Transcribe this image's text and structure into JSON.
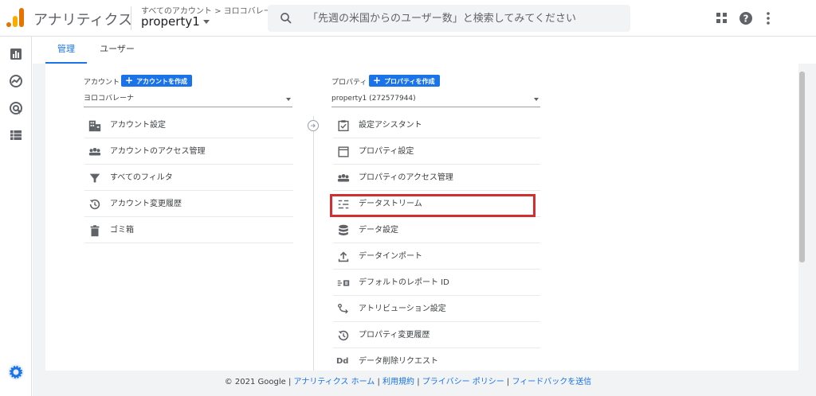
{
  "header": {
    "app_title": "アナリティクス",
    "breadcrumb": "すべてのアカウント > ヨロコバレーナ",
    "property_name": "property1",
    "search_placeholder": "「先週の米国からのユーザー数」と検索してみてください"
  },
  "tabs": [
    {
      "label": "管理",
      "active": true
    },
    {
      "label": "ユーザー",
      "active": false
    }
  ],
  "account": {
    "label": "アカウント",
    "create_label": "アカウントを作成",
    "selected": "ヨロコバレーナ",
    "items": [
      {
        "label": "アカウント設定",
        "icon": "building-icon"
      },
      {
        "label": "アカウントのアクセス管理",
        "icon": "people-icon"
      },
      {
        "label": "すべてのフィルタ",
        "icon": "filter-icon"
      },
      {
        "label": "アカウント変更履歴",
        "icon": "history-icon"
      },
      {
        "label": "ゴミ箱",
        "icon": "trash-icon"
      }
    ]
  },
  "property": {
    "label": "プロパティ",
    "create_label": "プロパティを作成",
    "selected": "property1 (272577944)",
    "items": [
      {
        "label": "設定アシスタント",
        "icon": "checkbox-icon"
      },
      {
        "label": "プロパティ設定",
        "icon": "window-icon"
      },
      {
        "label": "プロパティのアクセス管理",
        "icon": "people-icon"
      },
      {
        "label": "データストリーム",
        "icon": "stream-icon"
      },
      {
        "label": "データ設定",
        "icon": "database-icon"
      },
      {
        "label": "データインポート",
        "icon": "upload-icon"
      },
      {
        "label": "デフォルトのレポート ID",
        "icon": "report-id-icon"
      },
      {
        "label": "アトリビューション設定",
        "icon": "attribution-icon"
      },
      {
        "label": "プロパティ変更履歴",
        "icon": "history-icon"
      },
      {
        "label": "データ削除リクエスト",
        "icon": "dd-icon"
      }
    ]
  },
  "footer": {
    "copyright": "© 2021 Google",
    "links": [
      "アナリティクス ホーム",
      "利用規約",
      "プライバシー ポリシー",
      "フィードバックを送信"
    ]
  },
  "colors": {
    "accent": "#1a73e8",
    "highlight": "#d32f2f",
    "logo_orange": "#f9ab00",
    "logo_dark": "#e37400"
  }
}
